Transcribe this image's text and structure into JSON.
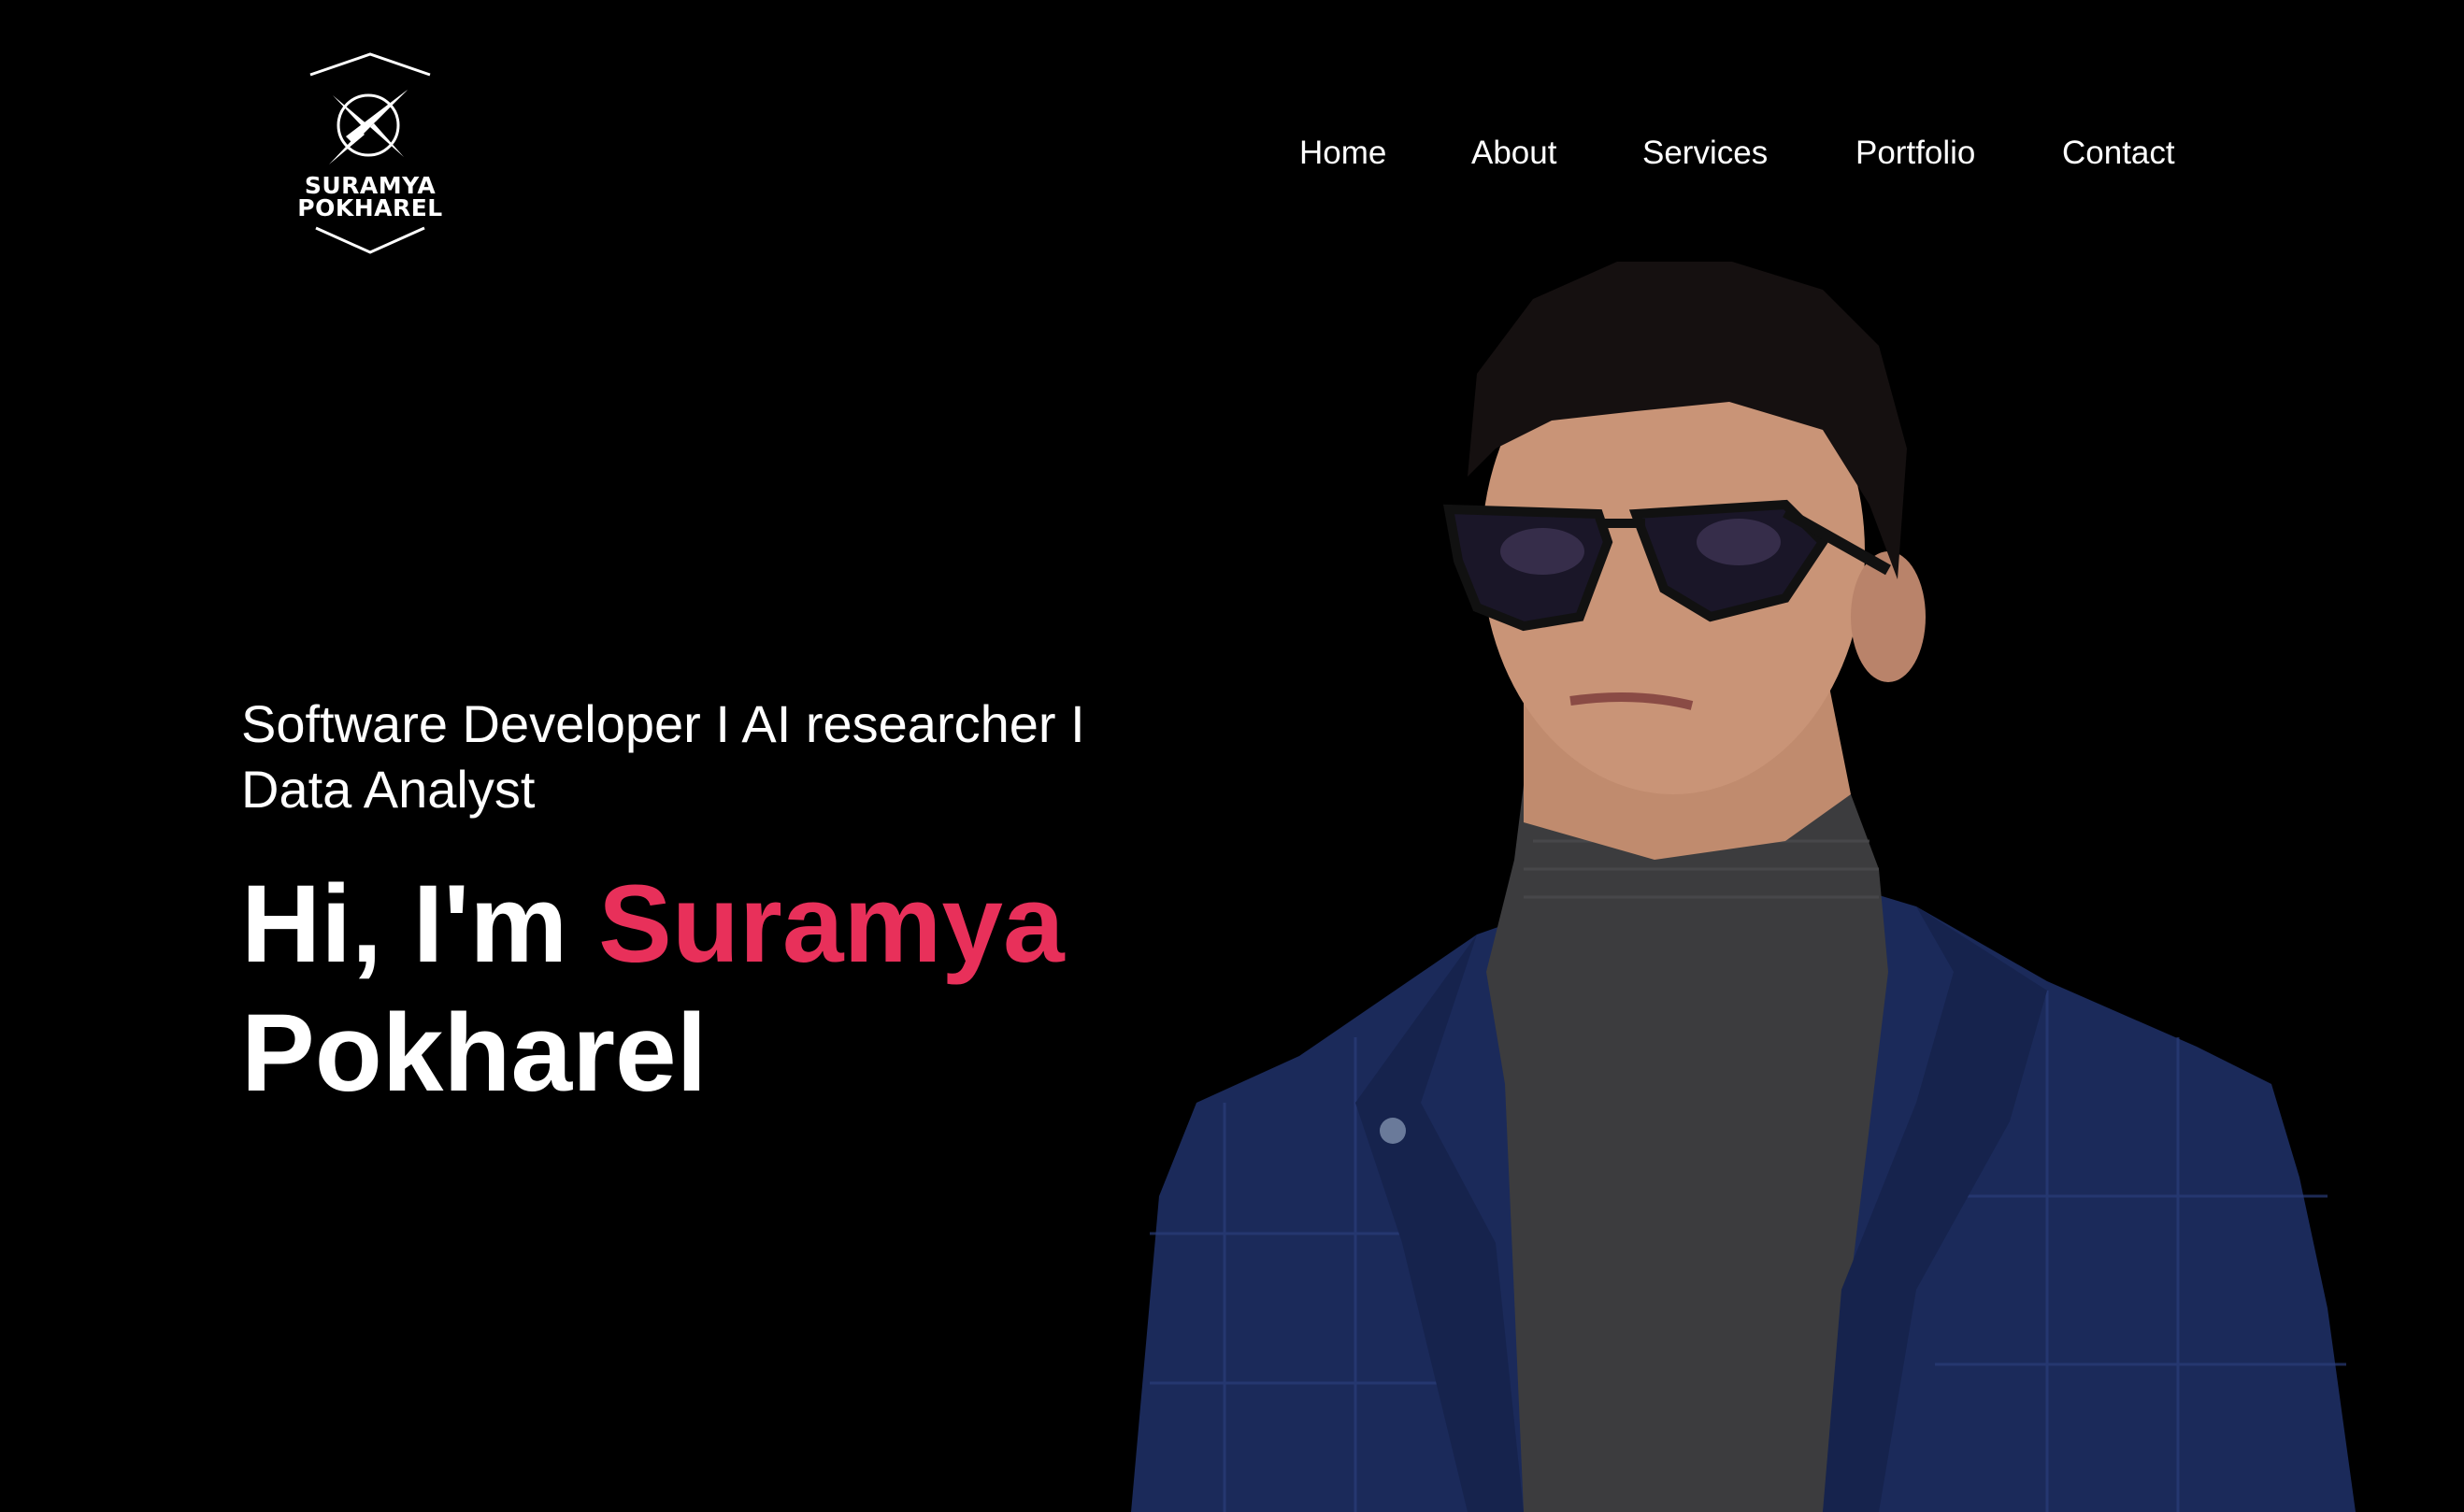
{
  "brand": {
    "name_line1": "SURAMYA",
    "name_line2": "POKHAREL"
  },
  "nav": {
    "items": [
      {
        "label": "Home"
      },
      {
        "label": "About"
      },
      {
        "label": "Services"
      },
      {
        "label": "Portfolio"
      },
      {
        "label": "Contact"
      }
    ]
  },
  "hero": {
    "subtitle_line1": "Software Developer I AI researcher I",
    "subtitle_line2": "Data Analyst",
    "greeting": "Hi, I'm",
    "first_name": "Suramya",
    "last_name": "Pokharel"
  },
  "colors": {
    "background": "#000000",
    "text": "#ffffff",
    "accent": "#e8305a",
    "jacket": "#1b2a5a",
    "turtleneck": "#3c3c3e"
  },
  "portrait": {
    "subject": "man-in-sunglasses-blue-blazer-portrait"
  }
}
